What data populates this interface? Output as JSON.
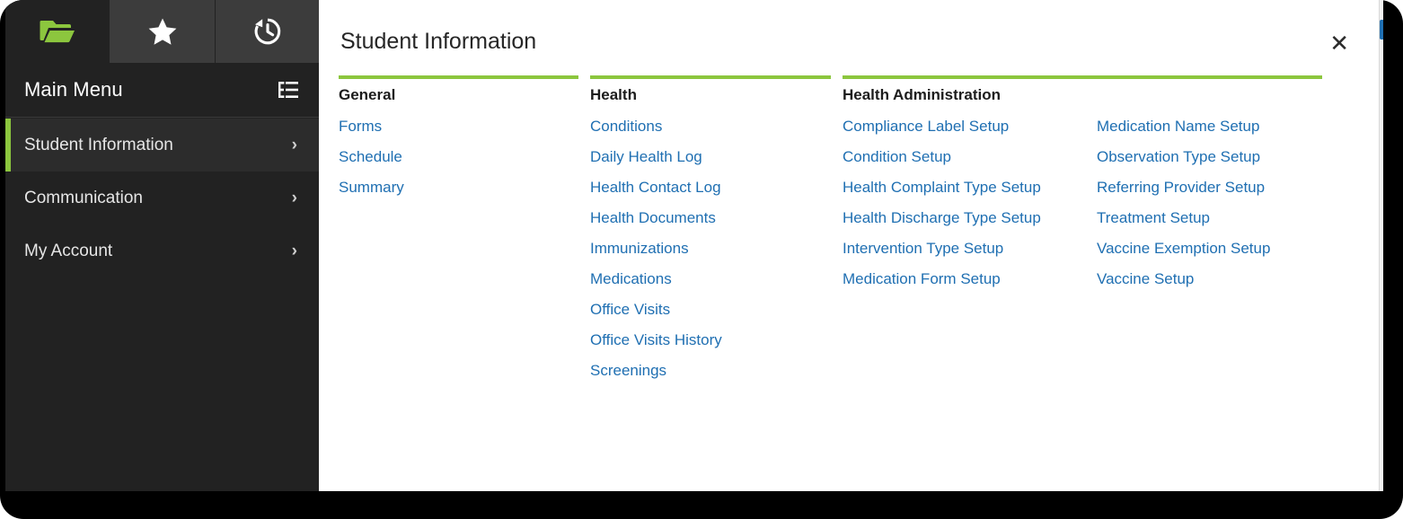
{
  "sidebar": {
    "tabs": [
      {
        "name": "open-folder",
        "icon": "open-folder-icon",
        "active": true
      },
      {
        "name": "favorites",
        "icon": "star-icon",
        "active": false
      },
      {
        "name": "history",
        "icon": "history-icon",
        "active": false
      }
    ],
    "header": {
      "title": "Main Menu",
      "toggle_icon": "tree-list-icon"
    },
    "items": [
      {
        "label": "Student Information",
        "selected": true,
        "chevron": "›"
      },
      {
        "label": "Communication",
        "selected": false,
        "chevron": "›"
      },
      {
        "label": "My Account",
        "selected": false,
        "chevron": "›"
      }
    ]
  },
  "panel": {
    "title": "Student Information",
    "close_label": "✕",
    "groups": [
      {
        "title": "General",
        "columns": [
          [
            "Forms",
            "Schedule",
            "Summary"
          ]
        ]
      },
      {
        "title": "Health",
        "columns": [
          [
            "Conditions",
            "Daily Health Log",
            "Health Contact Log",
            "Health Documents",
            "Immunizations",
            "Medications",
            "Office Visits",
            "Office Visits History",
            "Screenings"
          ]
        ]
      },
      {
        "title": "Health Administration",
        "columns": [
          [
            "Compliance Label Setup",
            "Condition Setup",
            "Health Complaint Type Setup",
            "Health Discharge Type Setup",
            "Intervention Type Setup",
            "Medication Form Setup"
          ],
          [
            "Medication Name Setup",
            "Observation Type Setup",
            "Referring Provider Setup",
            "Treatment Setup",
            "Vaccine Exemption Setup",
            "Vaccine Setup"
          ]
        ]
      }
    ]
  },
  "colors": {
    "accent_green": "#8CC63E",
    "link_blue": "#1F6FB2",
    "sidebar_bg": "#222222",
    "sidebar_tab_bg": "#3C3C3C",
    "sidebar_selected_bg": "#2C2C2C",
    "panel_bg": "#FFFFFF",
    "frame_black": "#000000"
  }
}
